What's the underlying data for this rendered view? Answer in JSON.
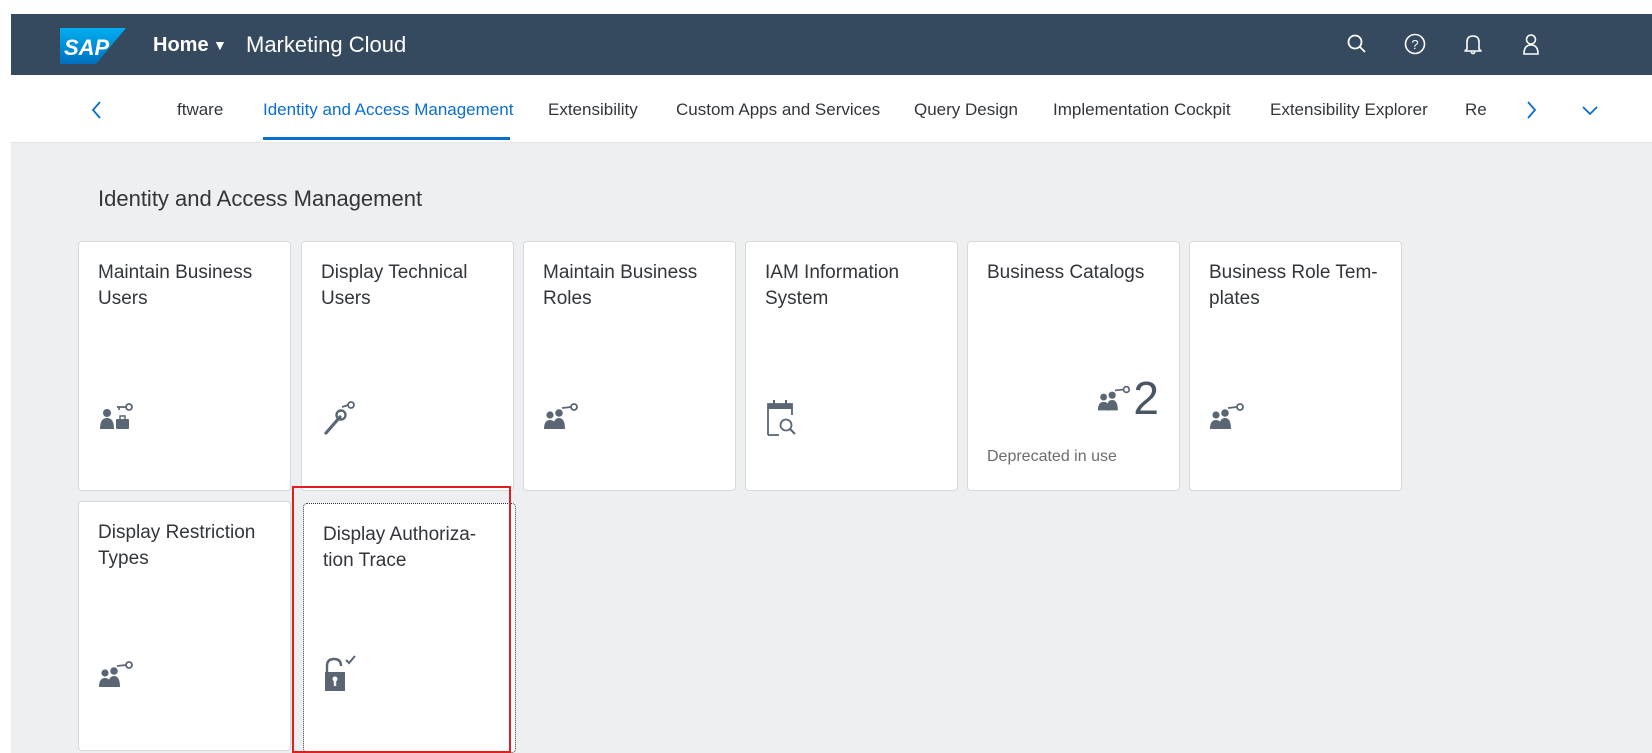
{
  "header": {
    "logo_text": "SAP",
    "home_label": "Home",
    "app_title": "Marketing Cloud",
    "icons": [
      "search-icon",
      "help-icon",
      "bell-icon",
      "user-icon"
    ],
    "bg_color": "#354a5f"
  },
  "tabs": {
    "items": [
      {
        "label": "ftware"
      },
      {
        "label": "Identity and Access Management",
        "active": true
      },
      {
        "label": "Extensibility"
      },
      {
        "label": "Custom Apps and Services"
      },
      {
        "label": "Query Design"
      },
      {
        "label": "Implementation Cockpit"
      },
      {
        "label": "Extensibility Explorer"
      },
      {
        "label": "Re"
      }
    ],
    "active_color": "#0a6ed1",
    "icons": [
      "chevron-left-icon",
      "chevron-right-icon",
      "chevron-down-icon"
    ]
  },
  "section": {
    "title": "Identity and Access Management",
    "tiles": [
      {
        "title": "Maintain Business Users",
        "icon": "business-user-key-icon"
      },
      {
        "title": "Display Technical Users",
        "icon": "wrench-key-icon"
      },
      {
        "title": "Maintain Business Roles",
        "icon": "group-key-icon"
      },
      {
        "title": "IAM Information System",
        "icon": "calendar-search-icon"
      },
      {
        "title": "Business Catalogs",
        "icon": "group-key-icon",
        "number": "2",
        "footer": "Deprecated in use"
      },
      {
        "title": "Business Role Tem-plates",
        "icon": "group-key-icon"
      },
      {
        "title": "Display Restriction Types",
        "icon": "group-key-icon"
      },
      {
        "title": "Display Authoriza-tion Trace",
        "icon": "unlocked-check-icon",
        "focused": true
      }
    ]
  }
}
